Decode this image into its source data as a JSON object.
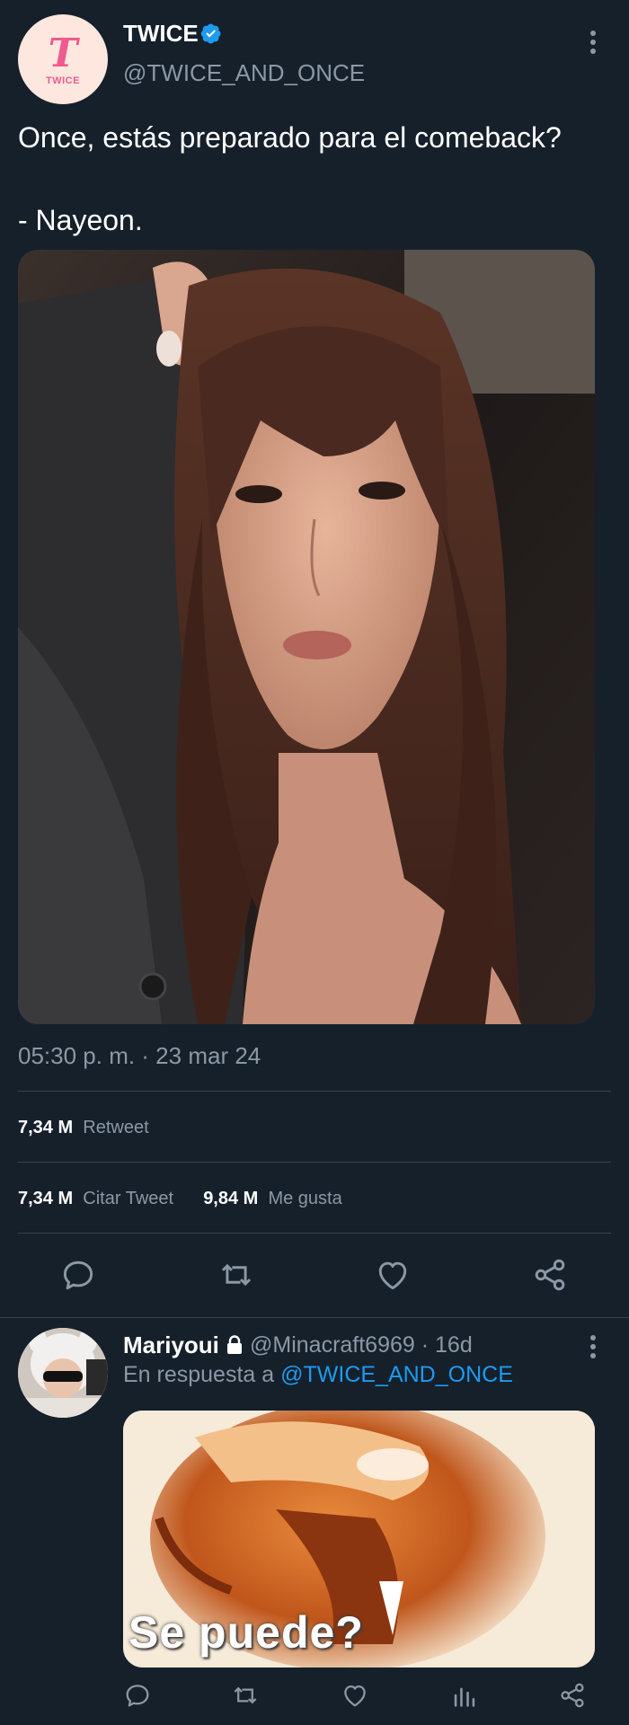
{
  "tweet": {
    "avatar_logo_text": "TWICE",
    "display_name": "TWICE",
    "handle": "@TWICE_AND_ONCE",
    "text": "Once, estás preparado para el comeback?\n\n- Nayeon.",
    "timestamp": "05:30 p. m. · 23 mar 24",
    "retweets_count": "7,34 M",
    "retweets_label": "Retweet",
    "quotes_count": "7,34 M",
    "quotes_label": "Citar Tweet",
    "likes_count": "9,84 M",
    "likes_label": "Me gusta",
    "actions": [
      "reply-icon",
      "retweet-icon",
      "like-icon",
      "share-icon"
    ]
  },
  "reply": {
    "display_name": "Mariyoui",
    "handle_time": "@Minacraft6969 · 16d",
    "reply_prefix": "En respuesta a",
    "reply_to": "@TWICE_AND_ONCE",
    "media_caption": "Se puede?",
    "actions": [
      "reply-icon",
      "retweet-icon",
      "like-icon",
      "analytics-icon",
      "share-icon"
    ]
  },
  "colors": {
    "background": "#15202b",
    "secondary_text": "#8b98a5",
    "accent": "#1d9bf0",
    "divider": "#38444d"
  }
}
